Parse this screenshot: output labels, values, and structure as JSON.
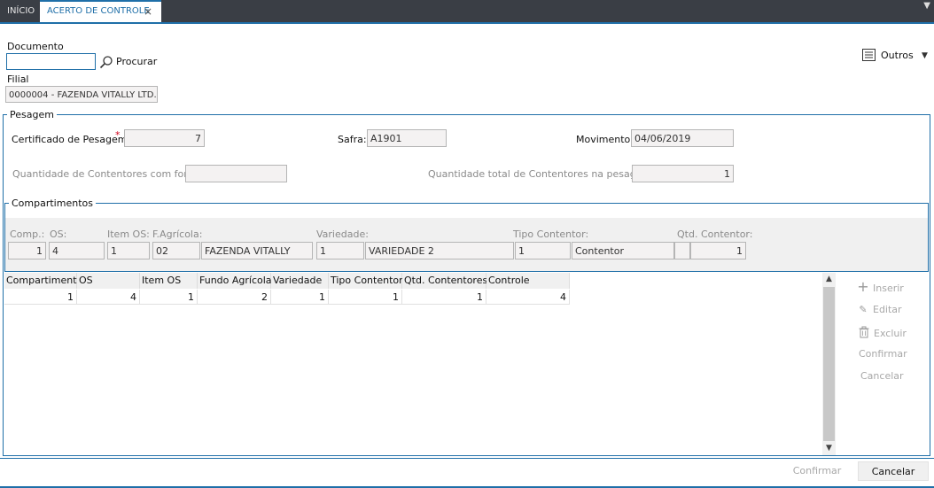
{
  "tabs": {
    "home": "INÍCIO",
    "active": "ACERTO DE CONTROLE",
    "close_icon": "×"
  },
  "documento": {
    "label": "Documento",
    "value": "",
    "search_label": "Procurar"
  },
  "outros_label": "Outros",
  "filial": {
    "label": "Filial",
    "value": "0000004 - FAZENDA VITALLY LTD."
  },
  "pesagem": {
    "title": "Pesagem",
    "certificado_label": "Certificado de Pesagem:",
    "required_mark": "*",
    "certificado_value": "7",
    "safra_label": "Safra:",
    "safra_value": "A1901",
    "movimento_label": "Movimento:",
    "movimento_value": "04/06/2019",
    "qtd_forro_label": "Quantidade de Contentores com forro:",
    "qtd_forro_value": "",
    "qtd_total_label": "Quantidade total de Contentores na pesagem:",
    "qtd_total_value": "1"
  },
  "compartimentos": {
    "title": "Compartimentos",
    "labels": {
      "comp": "Comp.:",
      "os": "OS:",
      "item_os": "Item OS:",
      "f_agricola": "F.Agrícola:",
      "variedade": "Variedade:",
      "tipo_contentor": "Tipo Contentor:",
      "qtd_contentor": "Qtd. Contentor:"
    },
    "values": {
      "comp": "1",
      "os": "4",
      "item_os": "1",
      "f_agricola_code": "02",
      "f_agricola_name": "FAZENDA VITALLY",
      "variedade_code": "1",
      "variedade_name": "VARIEDADE 2",
      "tipo_contentor_code": "1",
      "tipo_contentor_name": "Contentor",
      "qtd_contentor": "1"
    }
  },
  "grid": {
    "columns": [
      "Compartimento",
      "OS",
      "Item OS",
      "Fundo Agrícola",
      "Variedade",
      "Tipo Contentor",
      "Qtd. Contentores",
      "Controle"
    ],
    "rows": [
      [
        "1",
        "4",
        "1",
        "2",
        "1",
        "1",
        "1",
        "4"
      ]
    ]
  },
  "side_actions": {
    "inserir": "Inserir",
    "editar": "Editar",
    "excluir": "Excluir",
    "confirmar": "Confirmar",
    "cancelar": "Cancelar"
  },
  "footer": {
    "confirmar": "Confirmar",
    "cancelar": "Cancelar"
  },
  "colors": {
    "accent": "#1f6fa8",
    "tabbar": "#3a3e45",
    "required": "#d0021b"
  }
}
